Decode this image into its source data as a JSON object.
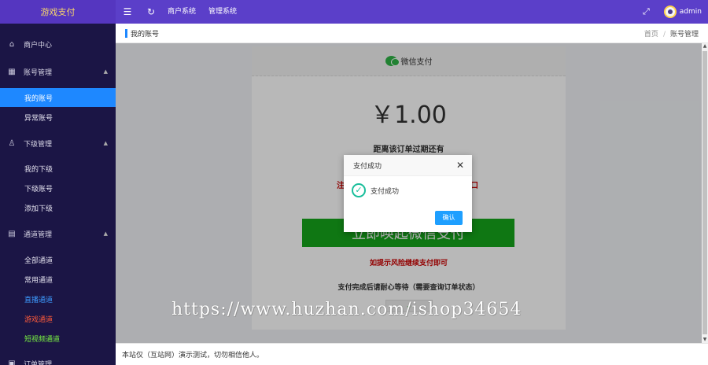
{
  "app": {
    "brand": "游戏支付",
    "nav_links": [
      "商户系统",
      "管理系统"
    ],
    "user": "admin"
  },
  "sidebar": {
    "items": [
      {
        "label": "商户中心",
        "icon": "home-icon"
      },
      {
        "label": "账号管理",
        "icon": "grid-icon"
      },
      {
        "label": "我的账号"
      },
      {
        "label": "异常账号"
      },
      {
        "label": "下级管理",
        "icon": "user-icon"
      },
      {
        "label": "我的下级"
      },
      {
        "label": "下级账号"
      },
      {
        "label": "添加下级"
      },
      {
        "label": "通道管理",
        "icon": "channel-icon"
      },
      {
        "label": "全部通道"
      },
      {
        "label": "常用通道"
      },
      {
        "label": "直播通道",
        "color": "#3d9bff"
      },
      {
        "label": "游戏通道",
        "color": "#ff5b3a"
      },
      {
        "label": "短视频通道",
        "color": "#7bf542"
      },
      {
        "label": "订单管理",
        "icon": "order-icon"
      }
    ]
  },
  "breadcrumb": {
    "title": "我的账号",
    "home": "首页",
    "sep": "/",
    "current": "账号管理"
  },
  "pay": {
    "method": "微信支付",
    "amount": "￥1.00",
    "expire_text": "距离该订单过期还有",
    "red_tip_left": "注",
    "red_tip_right": "口",
    "button": "立即唤起微信支付",
    "risk_tip": "如提示风险继续支付即可",
    "wait_tip": "支付完成后请耐心等待（需要查询订单状态）"
  },
  "modal": {
    "title": "支付成功",
    "message": "支付成功",
    "confirm": "确认"
  },
  "footer": {
    "text": "本站仅（互站网）演示测试，切勿相信他人。"
  },
  "watermark": "https://www.huzhan.com/ishop34654"
}
